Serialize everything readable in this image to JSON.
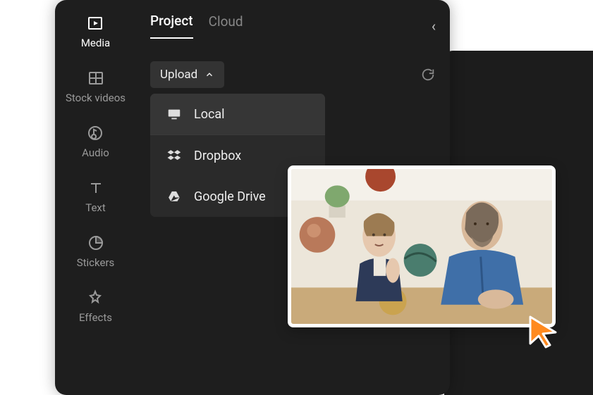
{
  "sidebar": {
    "items": [
      {
        "label": "Media"
      },
      {
        "label": "Stock videos"
      },
      {
        "label": "Audio"
      },
      {
        "label": "Text"
      },
      {
        "label": "Stickers"
      },
      {
        "label": "Effects"
      }
    ]
  },
  "tabs": {
    "project": "Project",
    "cloud": "Cloud"
  },
  "toolbar": {
    "upload_label": "Upload"
  },
  "dropdown": {
    "local": "Local",
    "dropbox": "Dropbox",
    "google_drive": "Google Drive"
  }
}
